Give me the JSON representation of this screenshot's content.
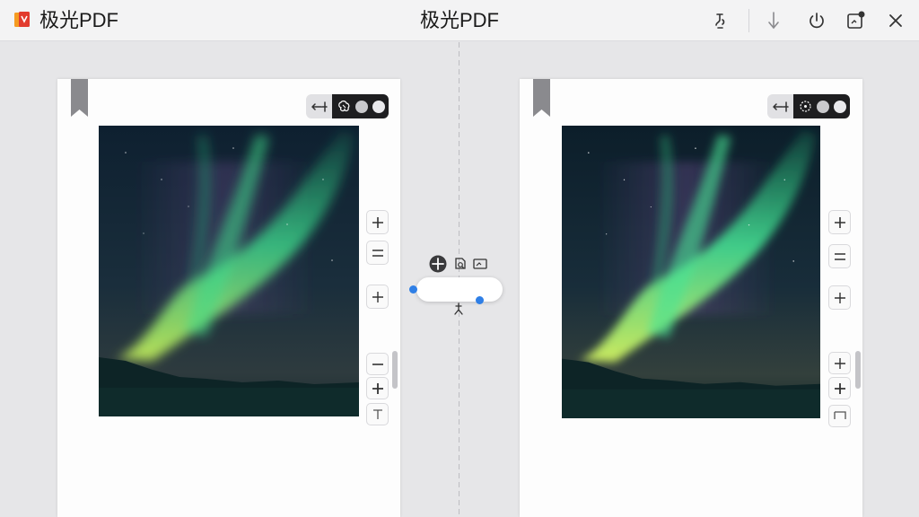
{
  "app": {
    "name": "极光PDF",
    "window_title": "极光PDF"
  },
  "titlebar": {
    "buttons": [
      {
        "name": "pin-icon"
      },
      {
        "name": "download-icon"
      },
      {
        "name": "power-icon"
      },
      {
        "name": "notes-icon"
      },
      {
        "name": "close-icon"
      }
    ]
  },
  "colors": {
    "accent": "#2f7fe6",
    "logo_red": "#e23b2e",
    "logo_orange": "#f59b21",
    "toggle_dark": "#1e1e20",
    "bookmark": "#8a8a8e"
  },
  "left_pane": {
    "view_toggle": {
      "left_icon": "compare-arrows-icon",
      "right_icon": "brain-icon"
    },
    "side_controls": [
      "zoom-in",
      "equals",
      "add",
      "minus",
      "add",
      "text-cursor"
    ]
  },
  "right_pane": {
    "view_toggle": {
      "left_icon": "compare-arrows-icon",
      "right_icon": "sparkle-circle-icon"
    },
    "side_controls": [
      "zoom-in",
      "equals",
      "add",
      "add",
      "add",
      "crop"
    ]
  },
  "floating_toolbar": {
    "icons": [
      "move-icon",
      "search-page-icon",
      "screen-capture-icon"
    ],
    "anchor_icon": "pin-anchor-icon"
  }
}
